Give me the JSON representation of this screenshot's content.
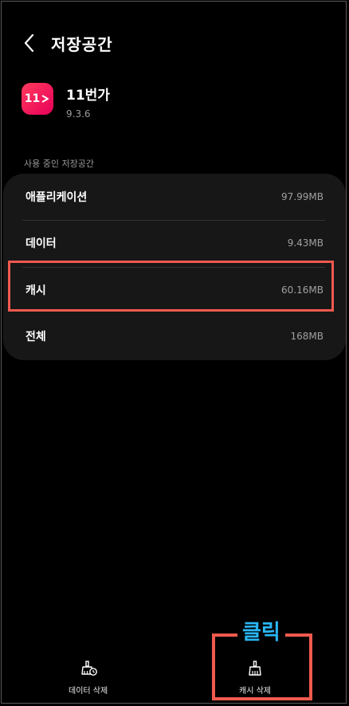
{
  "header": {
    "title": "저장공간"
  },
  "app": {
    "icon_text": "11",
    "name": "11번가",
    "version": "9.3.6"
  },
  "section_label": "사용 중인 저장공간",
  "storage": [
    {
      "label": "애플리케이션",
      "value": "97.99MB"
    },
    {
      "label": "데이터",
      "value": "9.43MB"
    },
    {
      "label": "캐시",
      "value": "60.16MB"
    },
    {
      "label": "전체",
      "value": "168MB"
    }
  ],
  "bottom": {
    "clear_data_label": "데이터 삭제",
    "clear_cache_label": "캐시 삭제"
  },
  "annotation": {
    "click_label": "클릭",
    "color": "#f05a4e",
    "text_color": "#29b6f6"
  },
  "icons": {
    "back": "chevron-left-icon",
    "clear_data": "broom-clock-icon",
    "clear_cache": "broom-icon"
  }
}
